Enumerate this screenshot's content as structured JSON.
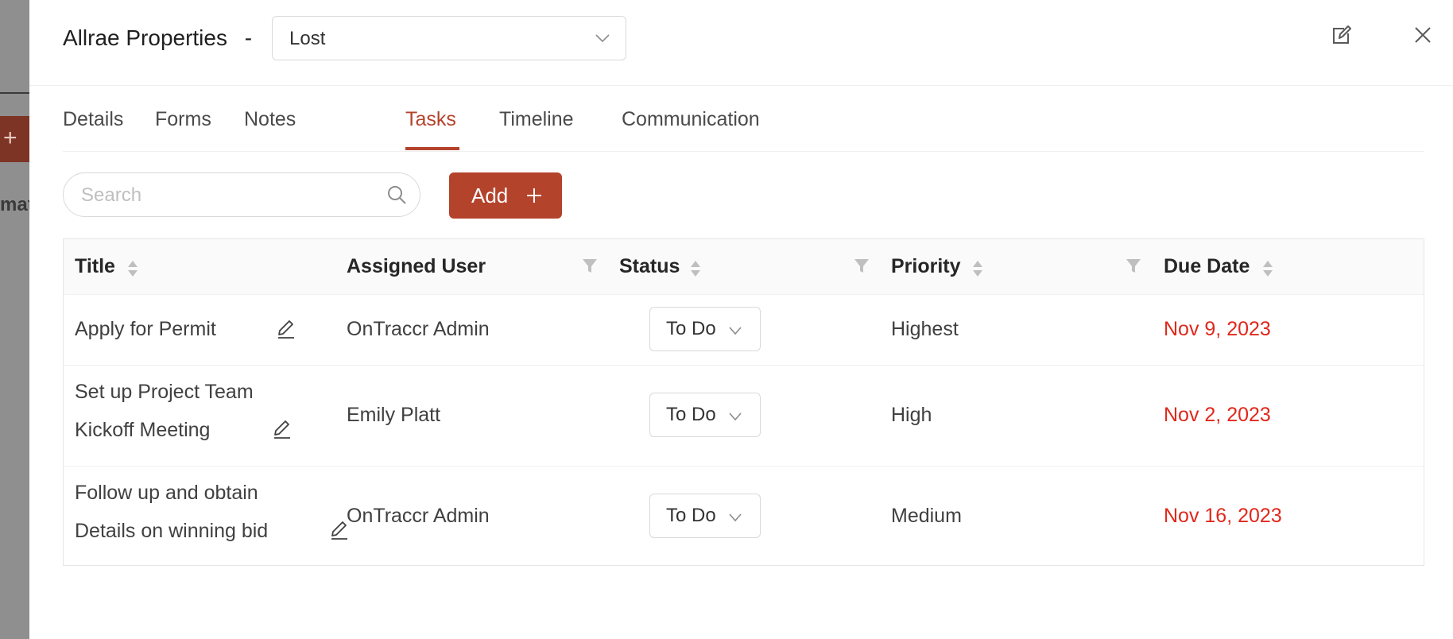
{
  "background": {
    "button_glyph": "+",
    "partial_text": "mat"
  },
  "drawer": {
    "title": "Allrae Properties",
    "separator": "-",
    "stage_value": "Lost"
  },
  "tabs": [
    {
      "label": "Details"
    },
    {
      "label": "Forms"
    },
    {
      "label": "Notes"
    },
    {
      "label": "Tasks"
    },
    {
      "label": "Timeline"
    },
    {
      "label": "Communication"
    }
  ],
  "active_tab": "Tasks",
  "search": {
    "placeholder": "Search",
    "value": ""
  },
  "add_button": {
    "label": "Add"
  },
  "table": {
    "columns": [
      "Title",
      "Assigned User",
      "Status",
      "Priority",
      "Due Date"
    ],
    "rows": [
      {
        "title_lines": [
          "Apply for Permit"
        ],
        "assigned": "OnTraccr Admin",
        "status": "To Do",
        "priority": "Highest",
        "due": "Nov 9, 2023"
      },
      {
        "title_lines": [
          "Set up Project Team",
          "Kickoff Meeting"
        ],
        "assigned": "Emily Platt",
        "status": "To Do",
        "priority": "High",
        "due": "Nov 2, 2023"
      },
      {
        "title_lines": [
          "Follow up and obtain",
          "Details on winning bid"
        ],
        "assigned": "OnTraccr Admin",
        "status": "To Do",
        "priority": "Medium",
        "due": "Nov 16, 2023"
      }
    ]
  },
  "colors": {
    "accent": "#b4432c",
    "due_date": "#e0281c"
  }
}
